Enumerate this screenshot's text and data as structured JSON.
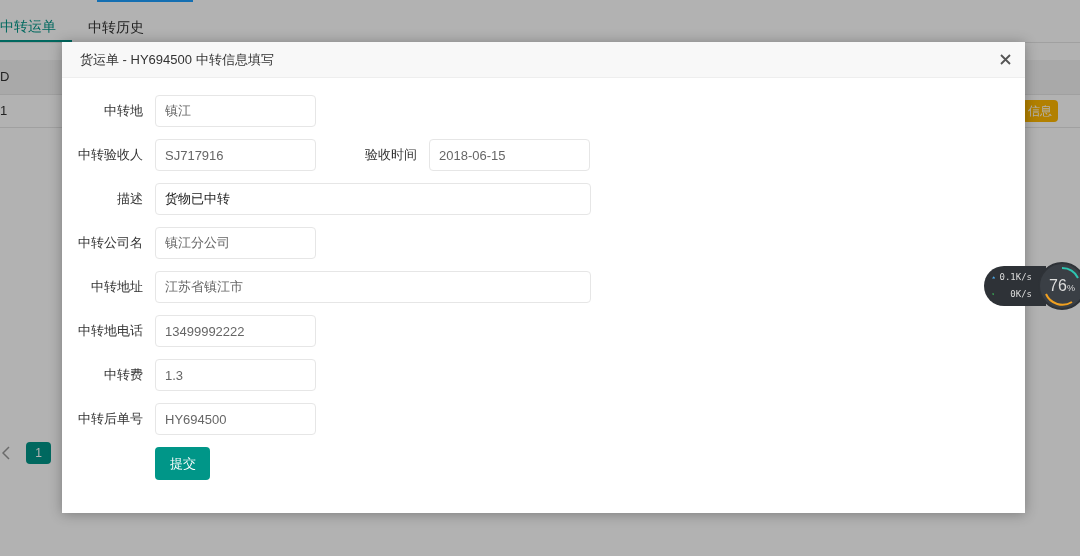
{
  "top_tabs": [
    {
      "label": "中转运单",
      "selected": true
    },
    {
      "label": "中转历史",
      "selected": false
    }
  ],
  "table": {
    "columns": [
      "D"
    ],
    "rows": [
      {
        "cells": [
          "1"
        ],
        "badge": "信息"
      }
    ]
  },
  "pagination": {
    "pages": [
      {
        "label": "1",
        "selected": true
      }
    ]
  },
  "modal": {
    "title": "货运单 - HY694500 中转信息填写",
    "rows": [
      [
        {
          "label": "中转地",
          "value": "镇江",
          "kind": "short",
          "readonly": true
        }
      ],
      [
        {
          "label": "中转验收人",
          "value": "SJ717916",
          "kind": "short",
          "readonly": true
        },
        {
          "label": "验收时间",
          "value": "2018-06-15",
          "kind": "short",
          "readonly": true
        }
      ],
      [
        {
          "label": "描述",
          "value": "货物已中转",
          "kind": "long",
          "readonly": false
        }
      ],
      [
        {
          "label": "中转公司名",
          "value": "镇江分公司",
          "kind": "short",
          "readonly": true
        }
      ],
      [
        {
          "label": "中转地址",
          "value": "江苏省镇江市",
          "kind": "long",
          "readonly": true
        }
      ],
      [
        {
          "label": "中转地电话",
          "value": "13499992222",
          "kind": "short",
          "readonly": true
        }
      ],
      [
        {
          "label": "中转费",
          "value": "1.3",
          "kind": "short",
          "readonly": true
        }
      ],
      [
        {
          "label": "中转后单号",
          "value": "HY694500",
          "kind": "short",
          "readonly": true
        }
      ]
    ],
    "submit": "提交"
  },
  "speed_widget": {
    "upload": "0.1K/s",
    "download": "0K/s",
    "percent": "76",
    "unit": "%"
  }
}
